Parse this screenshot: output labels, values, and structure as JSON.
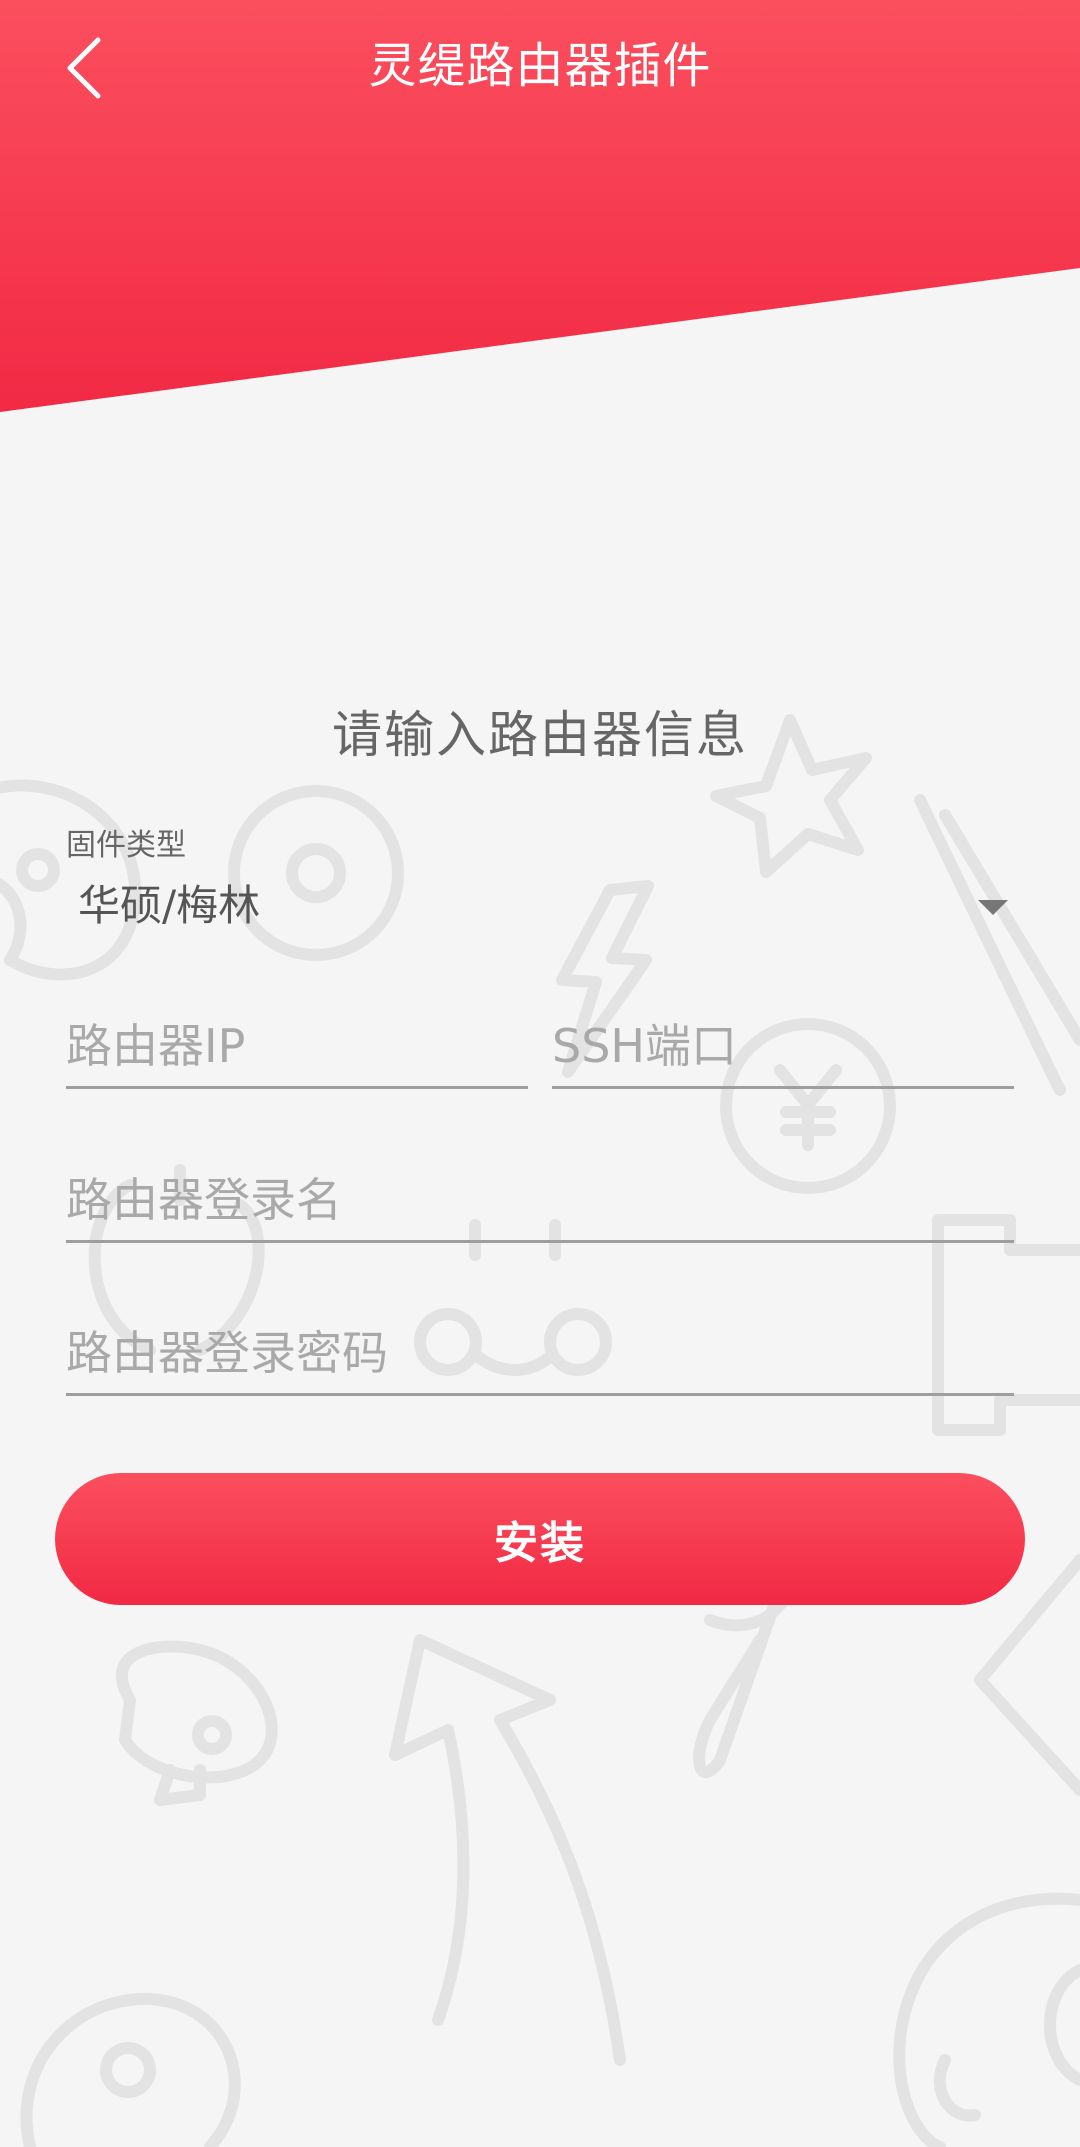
{
  "header": {
    "title": "灵缇路由器插件",
    "back_icon": "chevron-left-icon"
  },
  "form": {
    "heading": "请输入路由器信息",
    "firmware": {
      "label": "固件类型",
      "value": "华硕/梅林",
      "dropdown_icon": "caret-down-icon"
    },
    "router_ip": {
      "value": "",
      "placeholder": "路由器IP"
    },
    "ssh_port": {
      "value": "",
      "placeholder": "SSH端口"
    },
    "login_name": {
      "value": "",
      "placeholder": "路由器登录名"
    },
    "login_password": {
      "value": "",
      "placeholder": "路由器登录密码"
    },
    "install_label": "安装"
  },
  "colors": {
    "header_gradient_top": "#fb4f5e",
    "header_gradient_bottom": "#f22944",
    "background": "#f5f5f5",
    "doodle_stroke": "#e3e3e3",
    "field_underline": "#9e9e9e",
    "placeholder": "#a9a9a9"
  }
}
